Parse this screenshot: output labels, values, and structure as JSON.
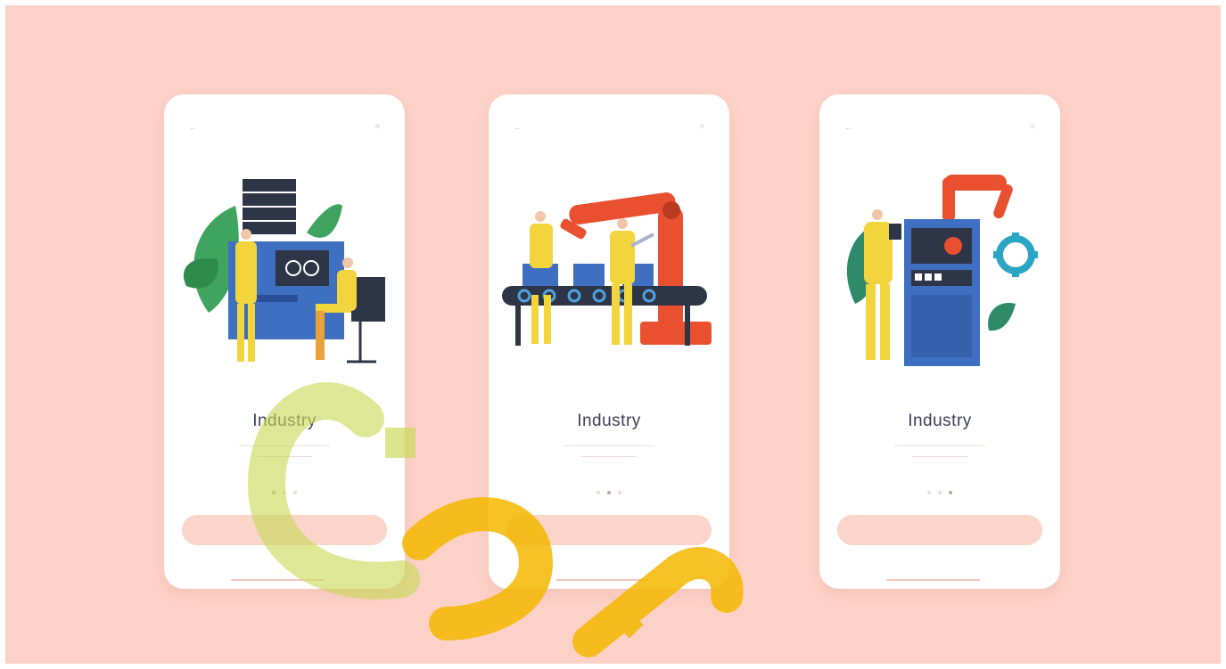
{
  "screens": [
    {
      "back_label": "←",
      "skip_label": "⊃",
      "title": "Industry",
      "description": "",
      "button_label": "",
      "active_dot": 0,
      "illustration": "operators-at-control-panel",
      "colors": {
        "blue": "#3f6fc0",
        "yellow": "#f2d43c",
        "leaf": "#3fa45f",
        "dark": "#2e3546"
      }
    },
    {
      "back_label": "←",
      "skip_label": "⊃",
      "title": "Industry",
      "description": "",
      "button_label": "",
      "active_dot": 1,
      "illustration": "robot-arm-conveyor-workers",
      "colors": {
        "red": "#e9502f",
        "yellow": "#f2d43c",
        "blue": "#3f6fc0",
        "dark": "#2e3546"
      }
    },
    {
      "back_label": "←",
      "skip_label": "⊃",
      "title": "Industry",
      "description": "",
      "button_label": "",
      "active_dot": 2,
      "illustration": "engineer-at-machine-with-gear",
      "colors": {
        "red": "#e9502f",
        "yellow": "#f2d43c",
        "blue": "#3f6fc0",
        "teal": "#2aa5c3",
        "leaf": "#2f8a6a"
      }
    }
  ],
  "background_color": "#fcd2c8",
  "cta_color": "#fbd4ca",
  "watermark": "ﺟﻮﺍ"
}
